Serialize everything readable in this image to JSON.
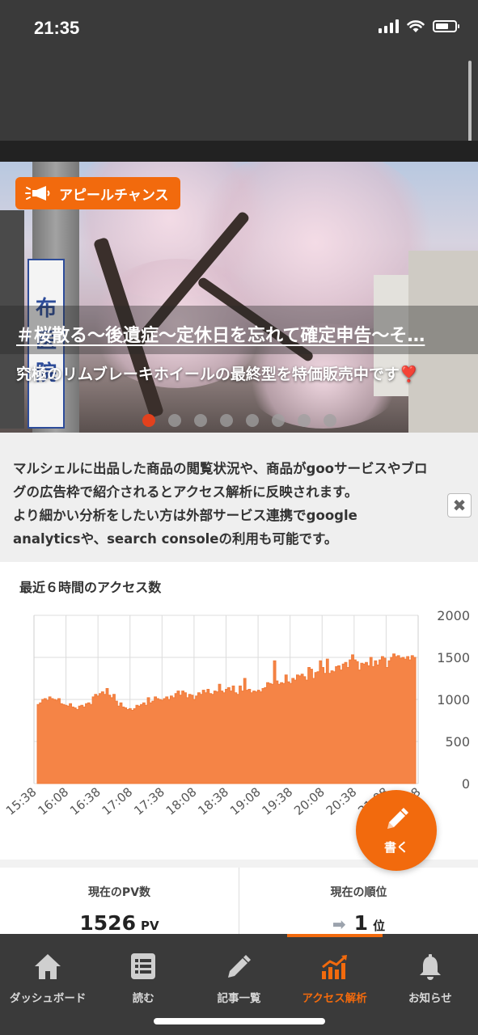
{
  "status_bar": {
    "time": "21:35"
  },
  "hero": {
    "badge": "アピールチャンス",
    "title": "＃桜散る～後遺症～定休日を忘れて確定申告～そ…",
    "subtitle": "究極のリムブレーキホイールの最終型を特価販売中です❣️",
    "sign_text": "布医院",
    "slide_count": 8,
    "active_slide": 0
  },
  "info": {
    "text_line1": "マルシェルに出品した商品の閲覧状況や、商品がgooサービスやブロ",
    "text_line2": "グの広告枠で紹介されるとアクセス解析に反映されます。",
    "text_line3": "より細かい分析をしたい方は外部サービス連携でgoogle",
    "text_line4": "analyticsや、search consoleの利用も可能です。",
    "close_label": "✖"
  },
  "chart_title": "最近６時間のアクセス数",
  "chart_data": {
    "type": "area",
    "title": "最近６時間のアクセス数",
    "xlabel": "",
    "ylabel": "",
    "ylim": [
      0,
      2000
    ],
    "y_ticks": [
      0,
      500,
      1000,
      1500,
      2000
    ],
    "x_tick_labels": [
      "15:38",
      "16:08",
      "16:38",
      "17:08",
      "17:38",
      "18:08",
      "18:38",
      "19:08",
      "19:38",
      "20:08",
      "20:38",
      "21:08",
      "21:38"
    ],
    "grid": true,
    "color": "#f58446",
    "series": [
      {
        "values": [
          940,
          960,
          1000,
          1010,
          990,
          1030,
          1010,
          1000,
          990,
          1010,
          950,
          940,
          930,
          920,
          950,
          910,
          900,
          880,
          920,
          930,
          910,
          950,
          960,
          940,
          1030,
          1060,
          1040,
          1070,
          1090,
          1060,
          1130,
          1050,
          1020,
          1060,
          980,
          920,
          960,
          910,
          900,
          880,
          890,
          870,
          890,
          930,
          920,
          940,
          960,
          930,
          1020,
          960,
          980,
          1030,
          1010,
          1000,
          990,
          1010,
          1030,
          1000,
          1040,
          1020,
          1070,
          1100,
          1050,
          1100,
          1080,
          1020,
          1060,
          1050,
          1000,
          1040,
          1080,
          1060,
          1110,
          1080,
          1120,
          1070,
          1060,
          1100,
          1090,
          1180,
          1100,
          1080,
          1120,
          1140,
          1100,
          1160,
          1080,
          1060,
          1160,
          1100,
          1250,
          1110,
          1120,
          1080,
          1100,
          1090,
          1110,
          1090,
          1130,
          1140,
          1200,
          1190,
          1180,
          1460,
          1220,
          1180,
          1200,
          1190,
          1290,
          1210,
          1190,
          1250,
          1230,
          1290,
          1280,
          1300,
          1270,
          1230,
          1380,
          1360,
          1250,
          1320,
          1330,
          1460,
          1380,
          1310,
          1480,
          1310,
          1340,
          1330,
          1390,
          1400,
          1350,
          1420,
          1440,
          1380,
          1470,
          1530,
          1470,
          1450,
          1350,
          1430,
          1420,
          1440,
          1400,
          1500,
          1390,
          1460,
          1410,
          1470,
          1510,
          1490,
          1380,
          1460,
          1500,
          1540,
          1510,
          1520,
          1490,
          1500,
          1480,
          1510,
          1470,
          1520,
          1500
        ]
      }
    ]
  },
  "stats": {
    "pv_label": "現在のPV数",
    "pv_value": "1526",
    "pv_unit": "PV",
    "rank_label": "現在の順位",
    "rank_value": "1",
    "rank_unit": "位"
  },
  "fab": {
    "label": "書く"
  },
  "nav": {
    "items": [
      {
        "label": "ダッシュボード",
        "icon": "home-icon"
      },
      {
        "label": "読む",
        "icon": "list-icon"
      },
      {
        "label": "記事一覧",
        "icon": "pencil-icon"
      },
      {
        "label": "アクセス解析",
        "icon": "chart-icon",
        "active": true
      },
      {
        "label": "お知らせ",
        "icon": "bell-icon"
      }
    ]
  },
  "colors": {
    "accent": "#f26a0d",
    "dark": "#3a3a3a",
    "area": "#f58446"
  }
}
